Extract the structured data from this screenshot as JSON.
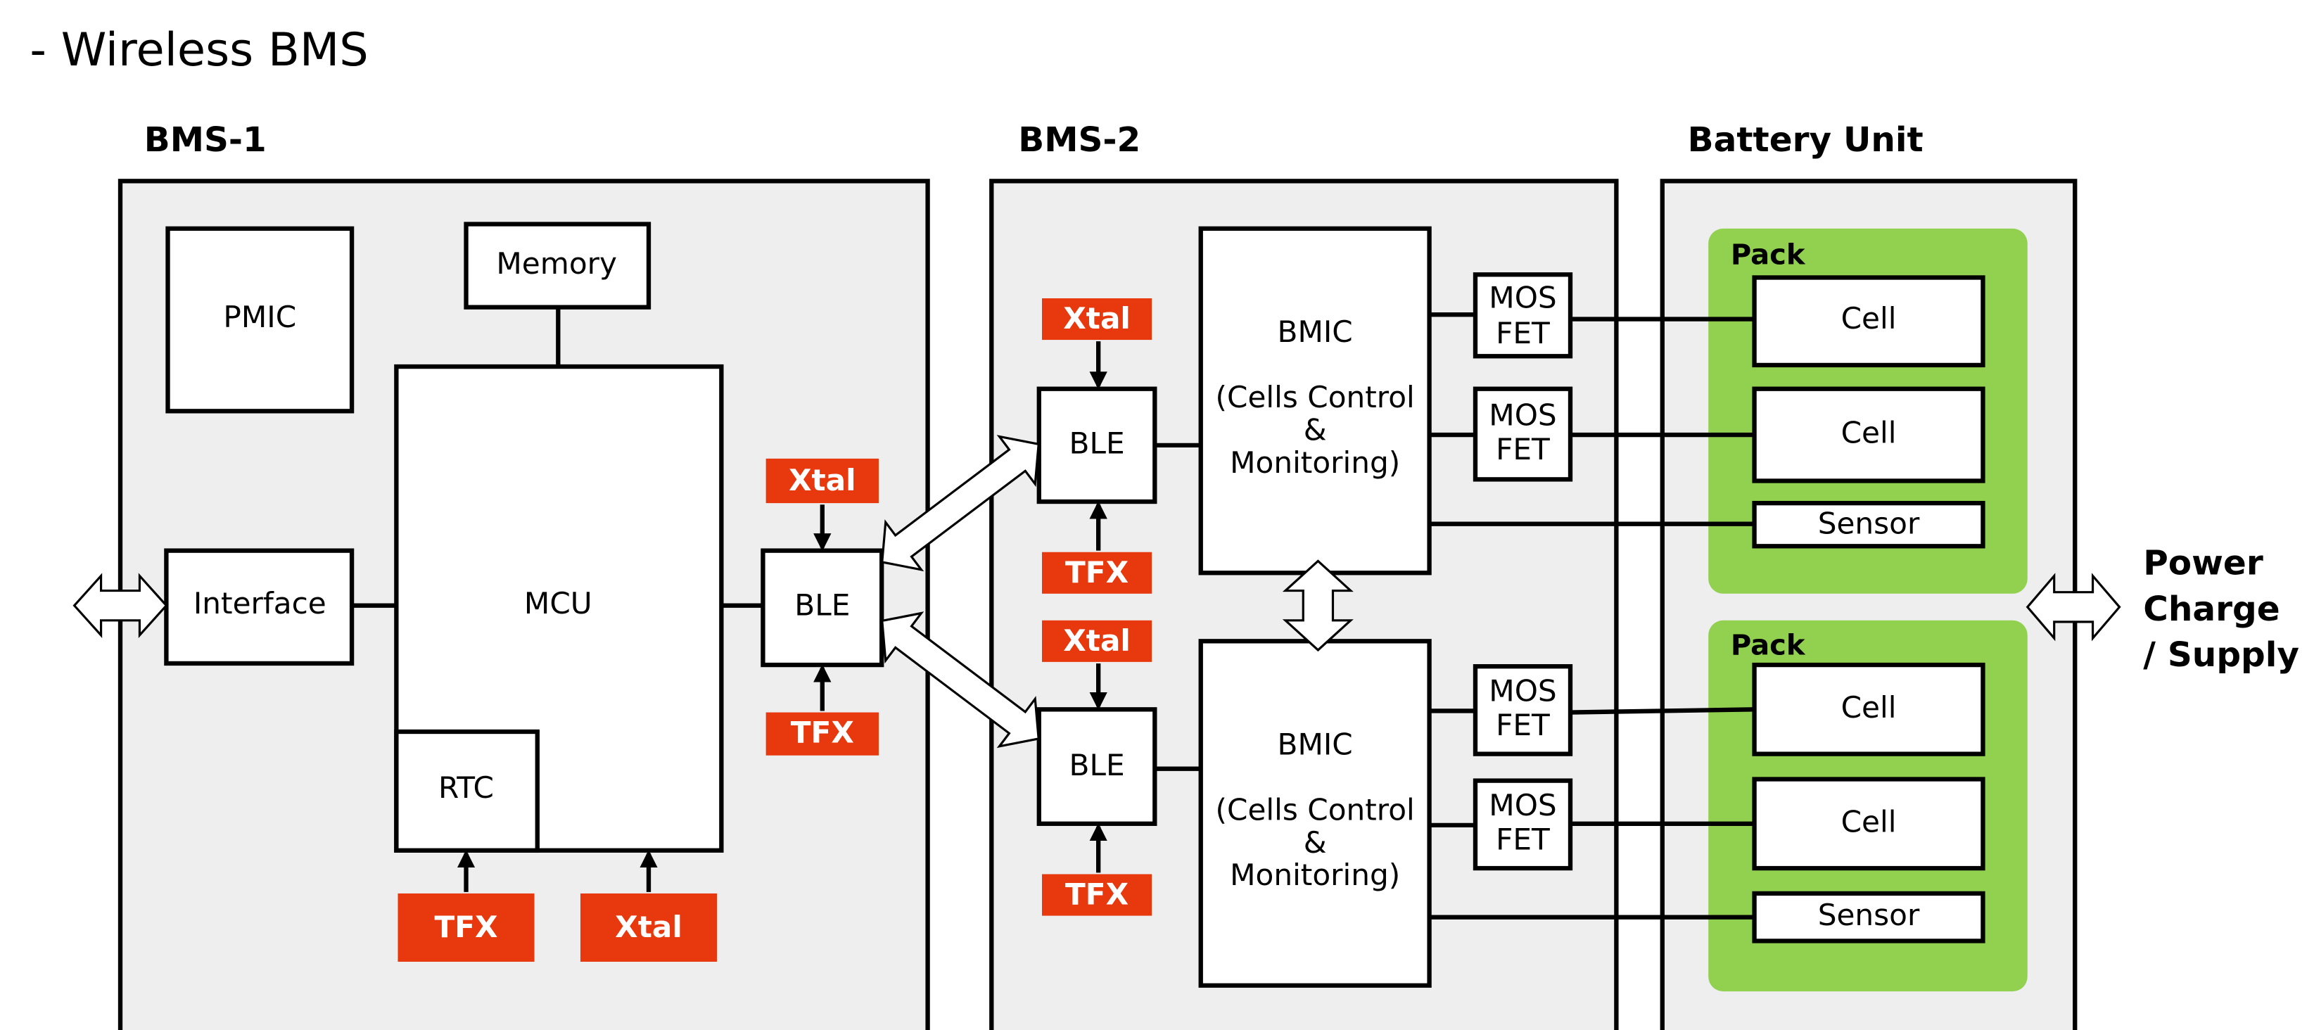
{
  "title": "- Wireless BMS",
  "colors": {
    "panel": "#eeeeee",
    "tag": "#e8380d",
    "pack": "#92d050"
  },
  "bms1": {
    "label": "BMS-1",
    "pmic": "PMIC",
    "memory": "Memory",
    "mcu": "MCU",
    "rtc": "RTC",
    "interface": "Interface",
    "ble": "BLE",
    "xtal": "Xtal",
    "tfx": "TFX",
    "rtc_tfx": "TFX",
    "mcu_xtal": "Xtal"
  },
  "bms2": {
    "label": "BMS-2",
    "ble_top": "BLE",
    "ble_bottom": "BLE",
    "xtal_top": "Xtal",
    "tfx_top": "TFX",
    "xtal_bottom": "Xtal",
    "tfx_bottom": "TFX",
    "bmic_title": "BMIC",
    "bmic_line1": "(Cells Control",
    "bmic_line2": "&",
    "bmic_line3": "Monitoring)",
    "mosfet_line1": "MOS",
    "mosfet_line2": "FET"
  },
  "battery": {
    "label": "Battery Unit",
    "pack": "Pack",
    "cell": "Cell",
    "sensor": "Sensor"
  },
  "power": {
    "line1": "Power",
    "line2": "Charge",
    "line3": "/ Supply"
  }
}
